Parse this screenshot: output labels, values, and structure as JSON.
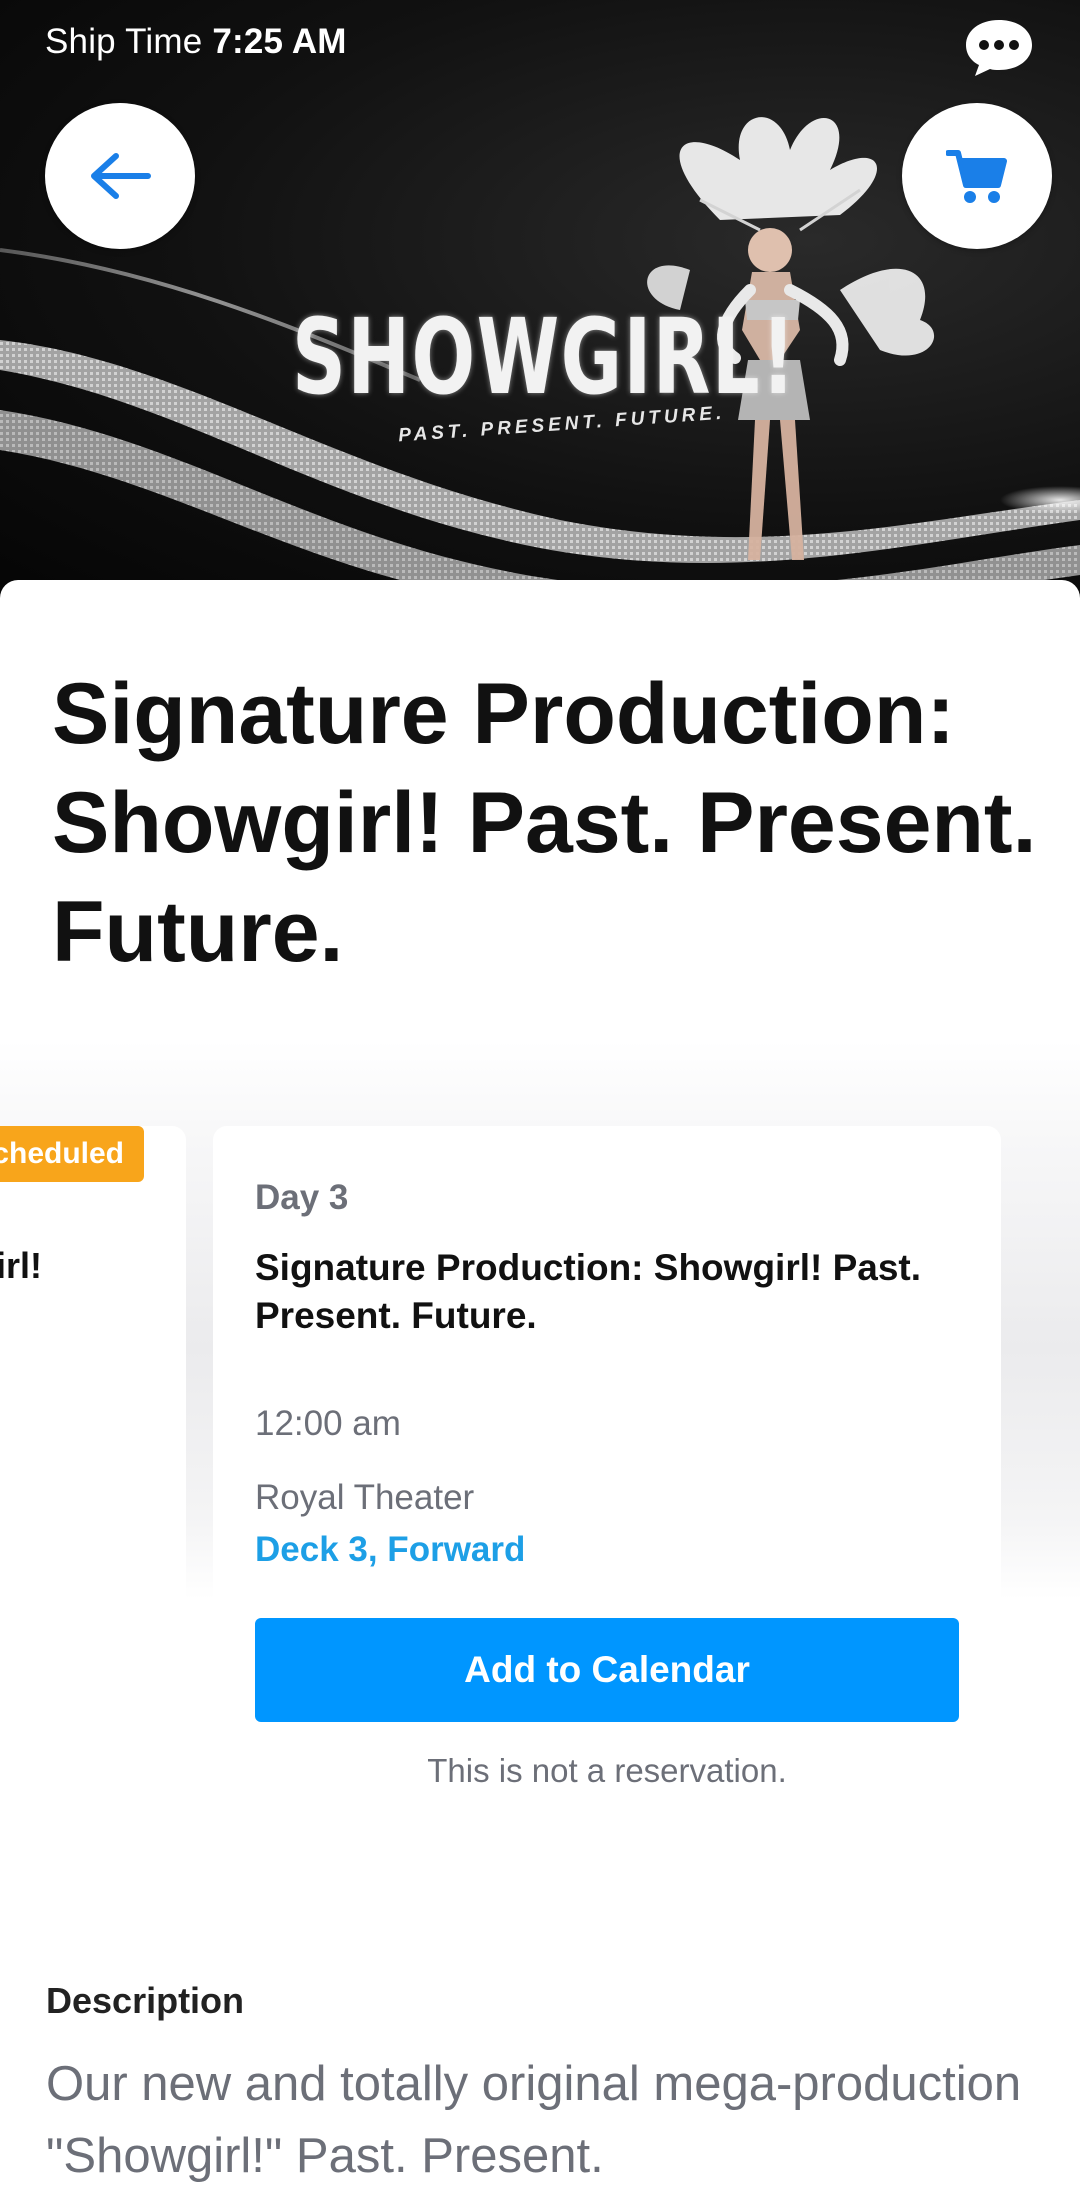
{
  "status_bar": {
    "label": "Ship Time",
    "time": "7:25 AM"
  },
  "header": {
    "back_icon": "arrow-left-icon",
    "cart_icon": "shopping-cart-icon",
    "chat_icon": "chat-bubble-icon",
    "accent_color": "#1a7fe8"
  },
  "hero": {
    "logo_text": "SHOWGIRL!",
    "logo_tagline": "PAST. PRESENT. FUTURE."
  },
  "event": {
    "title": "Signature Production: Showgirl! Past. Present. Future."
  },
  "previous_card": {
    "badge": "Scheduled",
    "title_fragment": "irl!",
    "badge_color": "#f8a51b"
  },
  "card": {
    "day": "Day 3",
    "title": "Signature Production: Showgirl! Past. Present. Future.",
    "time": "12:00 am",
    "venue": "Royal Theater",
    "deck": "Deck 3, Forward",
    "button_label": "Add to Calendar",
    "disclaimer": "This is not a reservation.",
    "button_color": "#0096ff",
    "deck_color": "#1d9fe6"
  },
  "description": {
    "heading": "Description",
    "body": "Our new and totally original mega-production \"Showgirl!\" Past. Present."
  }
}
